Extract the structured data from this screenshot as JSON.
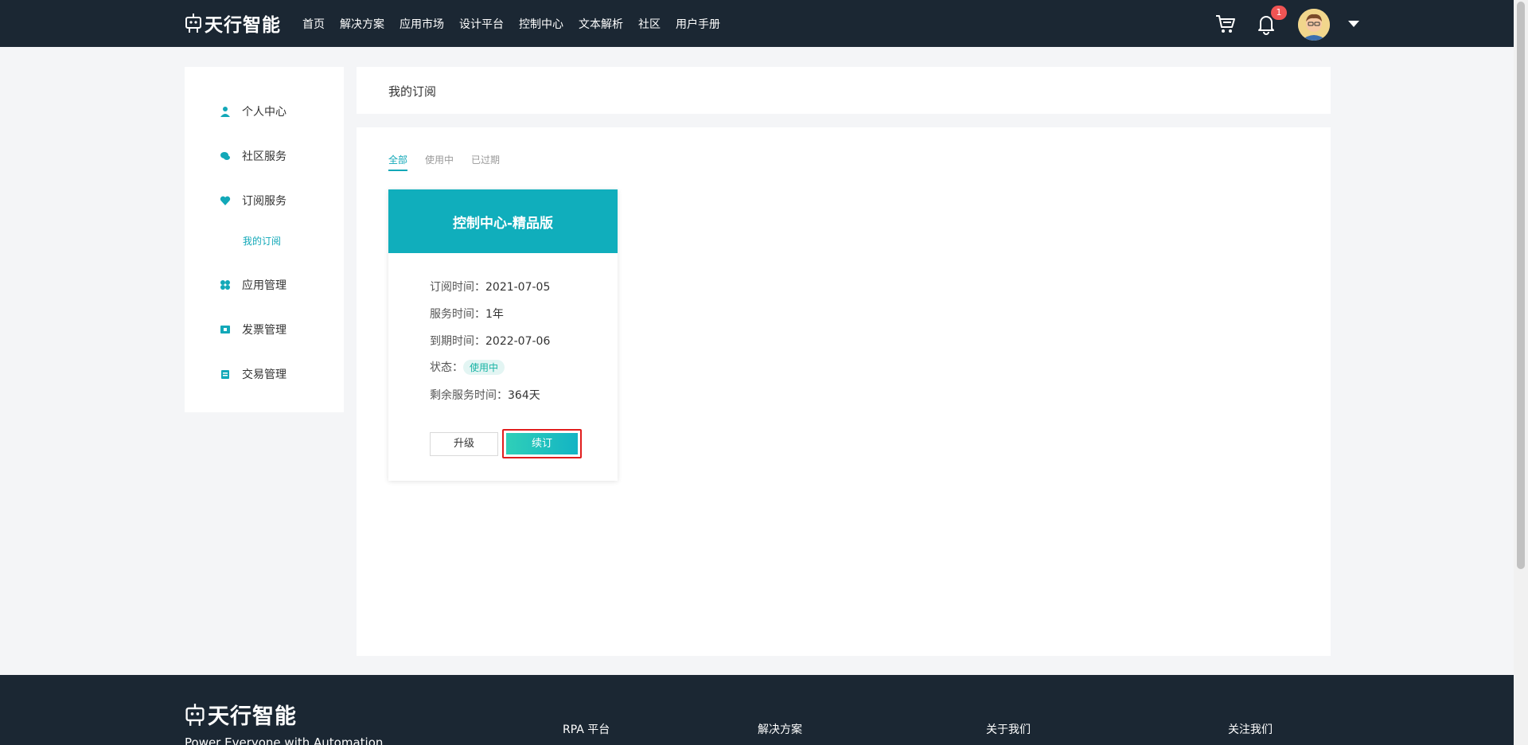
{
  "header": {
    "logo_text": "天行智能",
    "nav": [
      "首页",
      "解决方案",
      "应用市场",
      "设计平台",
      "控制中心",
      "文本解析",
      "社区",
      "用户手册"
    ],
    "notification_count": "1"
  },
  "sidebar": {
    "items": [
      {
        "label": "个人中心",
        "icon": "user-icon"
      },
      {
        "label": "社区服务",
        "icon": "chat-icon"
      },
      {
        "label": "订阅服务",
        "icon": "heart-icon"
      },
      {
        "label": "应用管理",
        "icon": "apps-icon"
      },
      {
        "label": "发票管理",
        "icon": "ticket-icon"
      },
      {
        "label": "交易管理",
        "icon": "clipboard-icon"
      }
    ],
    "sub_item": "我的订阅"
  },
  "page": {
    "title": "我的订阅",
    "tabs": [
      "全部",
      "使用中",
      "已过期"
    ]
  },
  "card": {
    "title": "控制中心-精品版",
    "rows": [
      {
        "label": "订阅时间：",
        "value": "2021-07-05"
      },
      {
        "label": "服务时间：",
        "value": "1年"
      },
      {
        "label": "到期时间：",
        "value": "2022-07-06"
      },
      {
        "label": "剩余服务时间：",
        "value": "364天"
      }
    ],
    "status_label": "状态：",
    "status_value": "使用中",
    "upgrade_label": "升级",
    "renew_label": "续订"
  },
  "footer": {
    "logo_text": "天行智能",
    "slogan": "Power Everyone with Automation",
    "columns": [
      "RPA 平台",
      "解决方案",
      "关于我们",
      "关注我们"
    ]
  },
  "colors": {
    "header_bg": "#1b2733",
    "accent": "#12a8b8",
    "card_head": "#10aebc",
    "highlight": "#e11d1d"
  }
}
